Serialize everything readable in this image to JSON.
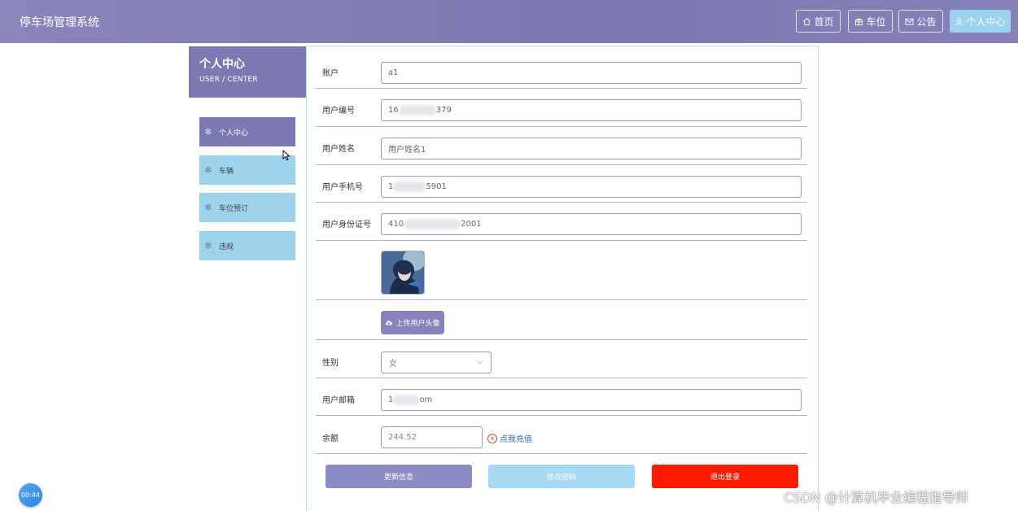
{
  "app": {
    "title": "停车场管理系统"
  },
  "nav": {
    "home": "首页",
    "parking": "车位",
    "notice": "公告",
    "user_center": "个人中心"
  },
  "sidebar": {
    "title": "个人中心",
    "subtitle": "USER / CENTER",
    "items": [
      {
        "label": "个人中心",
        "active": true
      },
      {
        "label": "车辆",
        "active": false
      },
      {
        "label": "车位预订",
        "active": false
      },
      {
        "label": "违规",
        "active": false
      }
    ]
  },
  "form": {
    "account": {
      "label": "账户",
      "value": "a1"
    },
    "user_no": {
      "label": "用户编号",
      "value_start": "16",
      "value_end": "379"
    },
    "user_name": {
      "label": "用户姓名",
      "value": "用户姓名1"
    },
    "phone": {
      "label": "用户手机号",
      "value_start": "1",
      "value_end": "5901"
    },
    "id_card": {
      "label": "用户身份证号",
      "value_start": "410",
      "value_end": "2001"
    },
    "upload_label": "上传用户头像",
    "gender": {
      "label": "性别",
      "value": "女"
    },
    "email": {
      "label": "用户邮箱",
      "value_start": "1",
      "value_end": "om"
    },
    "balance": {
      "label": "余额",
      "value": "244.52"
    },
    "recharge": "点我充值"
  },
  "actions": {
    "update": "更新信息",
    "change_password": "修改密码",
    "logout": "退出登录"
  },
  "overlay": {
    "timer": "00:44",
    "watermark": "CSDN @计算机毕业编程指导师"
  },
  "colors": {
    "header": "#7c79b3",
    "menu": "#9ed3ee",
    "update_button": "#8e8cc4",
    "password_button": "#a7d8f4",
    "logout_button": "#fe1a00"
  },
  "icons": {
    "home": "house-icon",
    "parking": "gift-icon",
    "notice": "mail-icon",
    "user": "user-icon",
    "menu": "snowflake-icon",
    "upload": "cloud-upload-icon",
    "select": "chevron-down-icon",
    "recharge": "yen-coin-icon"
  }
}
